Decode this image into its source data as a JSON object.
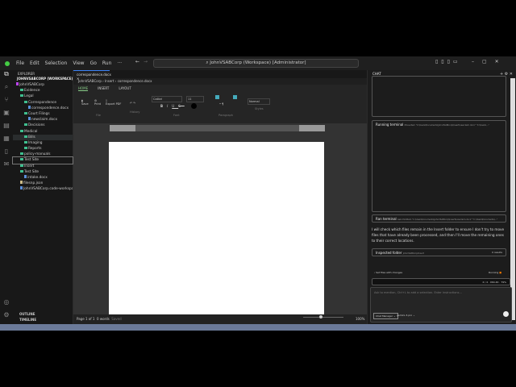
{
  "menu": [
    "File",
    "Edit",
    "Selection",
    "View",
    "Go",
    "Run",
    "···"
  ],
  "title_search": "JohnVSABCorp (Workspace) [Administrator]",
  "explorer": {
    "header": "EXPLORER",
    "workspace": "JOHNVSABCORP (WORKSPACE)",
    "items": [
      {
        "label": "JohnVSABCorp",
        "type": "root",
        "depth": 0
      },
      {
        "label": "Evidence",
        "type": "folder",
        "depth": 1
      },
      {
        "label": "Legal",
        "type": "folder",
        "depth": 1
      },
      {
        "label": "Correspondence",
        "type": "folder",
        "depth": 2
      },
      {
        "label": "correspondence.docx",
        "type": "file",
        "depth": 3
      },
      {
        "label": "Court Filings",
        "type": "folder",
        "depth": 2
      },
      {
        "label": "newclaim.docx",
        "type": "file",
        "depth": 3
      },
      {
        "label": "Decisions",
        "type": "folder",
        "depth": 2
      },
      {
        "label": "Medical",
        "type": "folder",
        "depth": 1
      },
      {
        "label": "Bills",
        "type": "folder",
        "depth": 2
      },
      {
        "label": "Imaging",
        "type": "folder",
        "depth": 2
      },
      {
        "label": "Reports",
        "type": "folder",
        "depth": 2
      },
      {
        "label": "policy-manuals",
        "type": "folder",
        "depth": 1
      },
      {
        "label": "Test Site",
        "type": "folder",
        "depth": 1
      },
      {
        "label": "Insert",
        "type": "folder",
        "depth": 1
      },
      {
        "label": "Test Site",
        "type": "folder",
        "depth": 1
      },
      {
        "label": "intake.docx",
        "type": "file",
        "depth": 2
      },
      {
        "label": "filesnp.json",
        "type": "json",
        "depth": 1
      },
      {
        "label": "JohnVSABCorp.code-workspace",
        "type": "file",
        "depth": 1
      }
    ],
    "outline": "OUTLINE",
    "timeline": "TIMELINE"
  },
  "editor": {
    "tab": "correspondence.docx",
    "breadcrumb": [
      "JohnVSABCorp",
      "Insert",
      "correspondence.docx"
    ],
    "ribbon_tabs": [
      "HOME",
      "INSERT",
      "LAYOUT"
    ],
    "toolbar": {
      "file_buttons": [
        "Save",
        "Print",
        "Export PDF"
      ],
      "file_group": "File",
      "history_group": "History",
      "font": "Calibri",
      "size": "11",
      "font_group": "Font",
      "format_buttons": [
        "B",
        "I",
        "U",
        "S"
      ],
      "para_group": "Paragraph",
      "style": "Normal",
      "style_group": "Styles"
    },
    "status": {
      "page": "Page 1 of 1",
      "words": "0 words",
      "saved": "Saved",
      "zoom": "100%"
    }
  },
  "chat": {
    "tab": "CHAT",
    "running_terminal": "Running terminal",
    "running_cmd": "Move-Item \"C:\\Users\\Documents\\JohnVSABCorp\\Insert\\newclaim.docx\" \"C:\\Users\\...\"",
    "ran_terminal": "Ran terminal",
    "ran_cmd": "Get-ChildItem \"C:\\Users\\Documents\\JohnVSABCorp\\Insert\\newclaim.docx\" \"C:\\Users\\Documents\\...\"",
    "message": "I will check which files remain in the Insert folder to ensure I don't try to move files that have already been processed, and then I'll move the remaining ones to their correct locations.",
    "inspected": "Inspected folder",
    "inspected_path": "JohnVSABCorp/Insert",
    "inspected_time": "0 results",
    "keep_files": "Set files with changes",
    "running": "Running",
    "progress_text": "4 / 4 · 064.4K · 79%",
    "input_placeholder": "Ask to mention, Ctrl+L to add a selection. Enter instructions...",
    "mode": "Chat Manager",
    "model": "gemini-3-pro"
  }
}
